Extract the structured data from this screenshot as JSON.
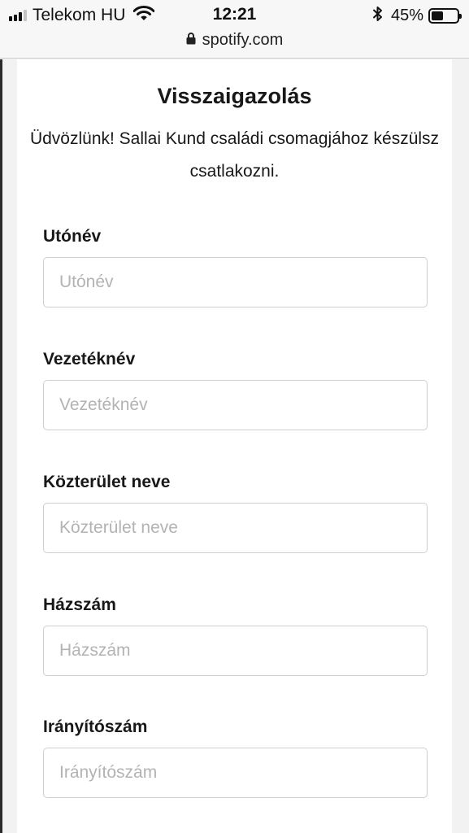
{
  "status_bar": {
    "carrier": "Telekom HU",
    "time": "12:21",
    "battery_percent": "45%",
    "battery_level": 0.45,
    "signal_bars_active": 3,
    "icons": [
      "signal-icon",
      "wifi-icon",
      "bluetooth-icon",
      "battery-icon"
    ]
  },
  "browser": {
    "url": "spotify.com",
    "lock_icon": "lock-icon"
  },
  "form": {
    "title": "Visszaigazolás",
    "subtitle": "Üdvözlünk! Sallai Kund családi csomagjához készülsz csatlakozni.",
    "fields": [
      {
        "label": "Utónév",
        "placeholder": "Utónév",
        "value": ""
      },
      {
        "label": "Vezetéknév",
        "placeholder": "Vezetéknév",
        "value": ""
      },
      {
        "label": "Közterület neve",
        "placeholder": "Közterület neve",
        "value": ""
      },
      {
        "label": "Házszám",
        "placeholder": "Házszám",
        "value": ""
      },
      {
        "label": "Irányítószám",
        "placeholder": "Irányítószám",
        "value": ""
      }
    ]
  }
}
